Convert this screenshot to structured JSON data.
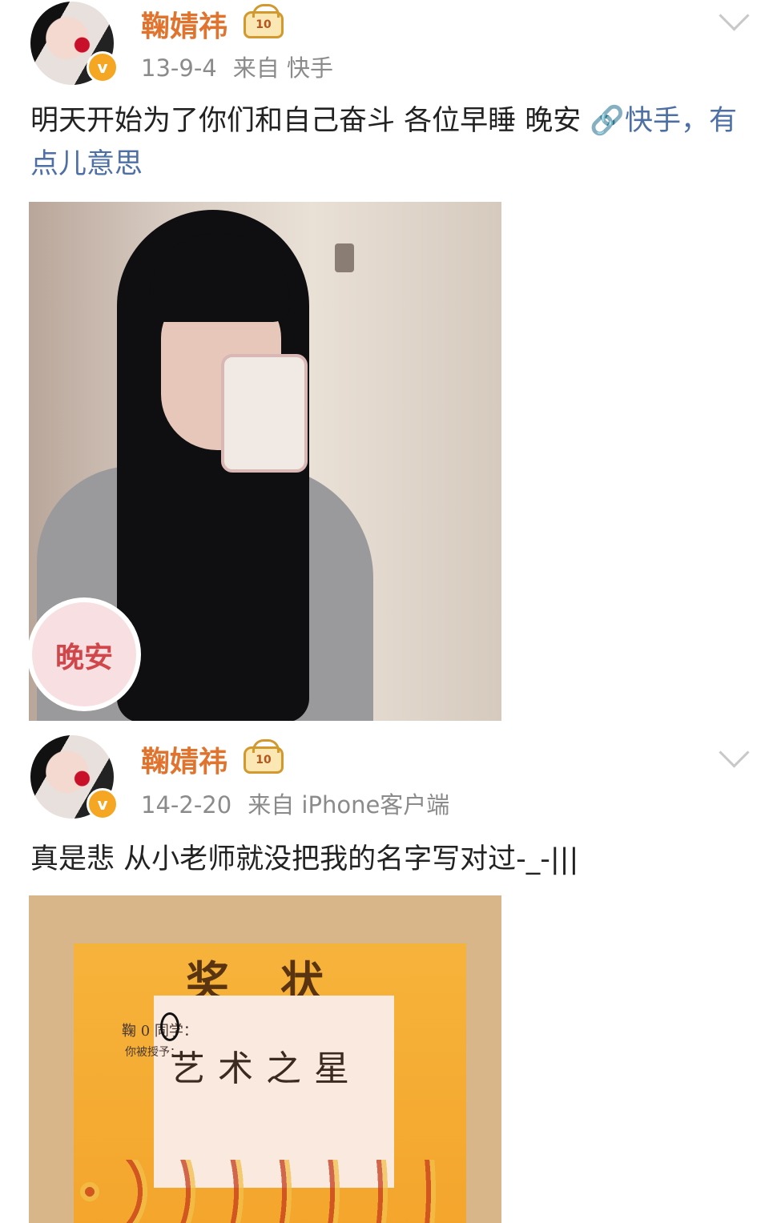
{
  "posts": [
    {
      "username": "鞠婧祎",
      "badge_text": "10",
      "date": "13-9-4",
      "source": "来自 快手",
      "content": "明天开始为了你们和自己奋斗 各位早睡 晚安 ",
      "link_text": "🔗快手，有点儿意思",
      "image_stamp": "晚安"
    },
    {
      "username": "鞠婧祎",
      "badge_text": "10",
      "date": "14-2-20",
      "source": "来自 iPhone客户端",
      "content": "真是悲 从小老师就没把我的名字写对过-_-|||",
      "certificate": {
        "title": "奖状",
        "line1": "鞠 0 同学：",
        "line2": "你被授予：",
        "award": "艺术之星"
      }
    }
  ],
  "verified_mark": "v",
  "colors": {
    "username": "#e0742f",
    "link": "#4e6fa5",
    "meta": "#8b8b8b"
  }
}
